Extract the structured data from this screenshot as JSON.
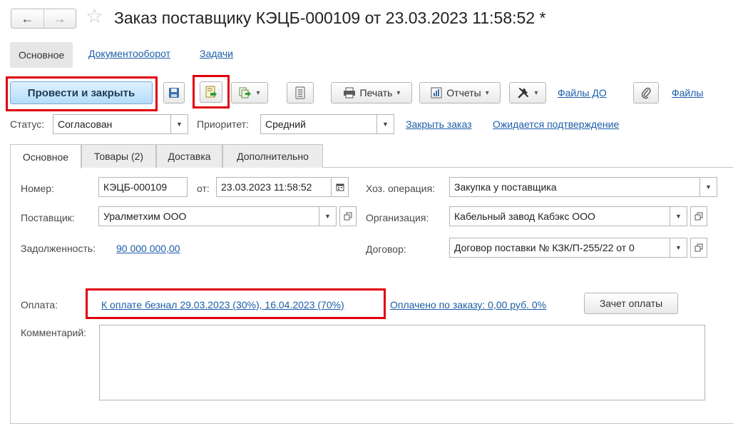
{
  "header": {
    "title": "Заказ поставщику КЭЦБ-000109 от 23.03.2023 11:58:52 *",
    "back_glyph": "←",
    "forward_glyph": "→",
    "star_glyph": "☆"
  },
  "sections": {
    "active": "Основное",
    "items": [
      "Документооборот",
      "Задачи"
    ]
  },
  "toolbar": {
    "post_and_close": "Провести и закрыть",
    "print": "Печать",
    "reports": "Отчеты",
    "files_do": "Файлы ДО",
    "files": "Файлы",
    "caret": "▾"
  },
  "status_row": {
    "status_label": "Статус:",
    "status_value": "Согласован",
    "priority_label": "Приоритет:",
    "priority_value": "Средний",
    "close_order": "Закрыть заказ",
    "awaiting_confirmation": "Ожидается подтверждение"
  },
  "tabs": [
    "Основное",
    "Товары (2)",
    "Доставка",
    "Дополнительно"
  ],
  "form": {
    "number_label": "Номер:",
    "number_value": "КЭЦБ-000109",
    "date_label": "от:",
    "date_value": "23.03.2023 11:58:52",
    "operation_label": "Хоз. операция:",
    "operation_value": "Закупка у поставщика",
    "supplier_label": "Поставщик:",
    "supplier_value": "Уралметхим ООО",
    "organization_label": "Организация:",
    "organization_value": "Кабельный завод Кабэкс ООО",
    "debt_label": "Задолженность:",
    "debt_value": "90 000 000,00",
    "contract_label": "Договор:",
    "contract_value": "Договор поставки № КЗК/П-255/22  от 0",
    "payment_label": "Оплата:",
    "payment_schedule": "К оплате безнал 29.03.2023 (30%), 16.04.2023 (70%)",
    "paid_by_order": "Оплачено по заказу: 0,00 руб. 0%",
    "offset_button": "Зачет оплаты",
    "comment_label": "Комментарий:"
  },
  "colors": {
    "link": "#1c5ea8",
    "highlight": "#e0000b",
    "primary_button": "#b5dcf8"
  }
}
